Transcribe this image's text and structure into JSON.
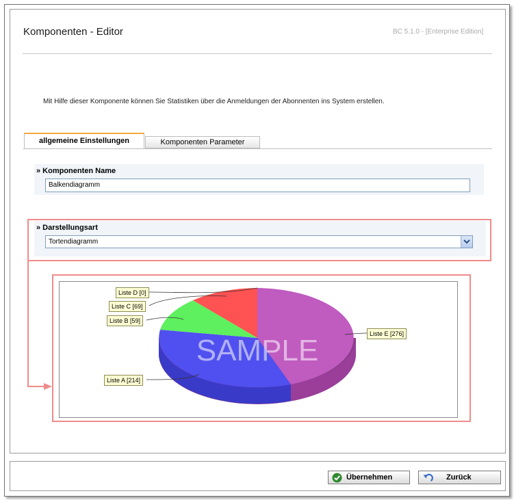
{
  "header": {
    "title": "Komponenten - Editor",
    "version": "BC 5.1.0 - [Enterprise Edition]"
  },
  "description": "Mit Hilfe dieser Komponente können Sie Statistiken über die Anmeldungen der Abonnenten ins System erstellen.",
  "tabs": [
    {
      "label": "allgemeine Einstellungen",
      "active": true
    },
    {
      "label": "Komponenten Parameter",
      "active": false
    }
  ],
  "name_section": {
    "label": "» Komponenten Name",
    "value": "Balkendiagramm"
  },
  "display_section": {
    "label": "» Darstellungsart",
    "selected": "Tortendiagramm"
  },
  "chart_data": {
    "type": "pie",
    "categories": [
      "Liste A",
      "Liste B",
      "Liste C",
      "Liste D",
      "Liste E"
    ],
    "values": [
      214,
      59,
      69,
      0,
      276
    ],
    "labels": [
      "Liste A [214]",
      "Liste B [59]",
      "Liste C [69]",
      "Liste D [0]",
      "Liste E [276]"
    ],
    "colors": [
      "#5a5aff",
      "#66ee66",
      "#ff5a5a",
      "#f0c000",
      "#cc66cc"
    ],
    "style": "3d",
    "watermark": "SAMPLE"
  },
  "buttons": {
    "apply_label": "Übernehmen",
    "back_label": "Zurück"
  },
  "icons": {
    "apply": "check-circle-icon",
    "back": "undo-arrow-icon",
    "dropdown": "chevron-down-icon"
  },
  "accent": {
    "tab_top": "#f3a73a",
    "annotation": "#f08a8a"
  }
}
